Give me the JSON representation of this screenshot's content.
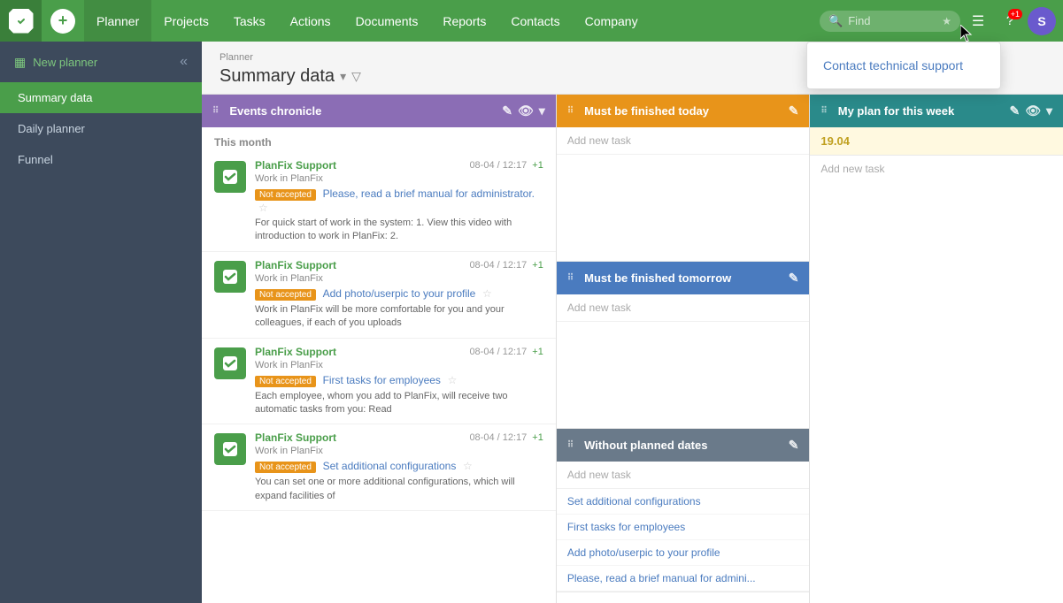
{
  "nav": {
    "logo_label": "F",
    "add_label": "+",
    "items": [
      {
        "label": "Planner",
        "active": true
      },
      {
        "label": "Projects"
      },
      {
        "label": "Tasks"
      },
      {
        "label": "Actions"
      },
      {
        "label": "Documents"
      },
      {
        "label": "Reports"
      },
      {
        "label": "Contacts"
      },
      {
        "label": "Company"
      }
    ],
    "search_placeholder": "Find",
    "avatar_label": "S",
    "badge_label": "+1"
  },
  "sidebar": {
    "new_planner_label": "New planner",
    "collapse_label": "«",
    "nav_items": [
      {
        "label": "Summary data",
        "active": true
      },
      {
        "label": "Daily planner"
      },
      {
        "label": "Funnel"
      }
    ]
  },
  "page": {
    "breadcrumb": "Planner",
    "title": "Summary data"
  },
  "events_panel": {
    "title": "Events chronicle",
    "month_label": "This month",
    "events": [
      {
        "author": "PlanFix Support",
        "time": "08-04 / 12:17",
        "plus": "+1",
        "project": "Work in PlanFix",
        "badge": "Not accepted",
        "task_link": "Please, read a brief manual for administrator.",
        "description": "For quick start of work in the system: 1. View this video with introduction to work in PlanFix: 2."
      },
      {
        "author": "PlanFix Support",
        "time": "08-04 / 12:17",
        "plus": "+1",
        "project": "Work in PlanFix",
        "badge": "Not accepted",
        "task_link": "Add photo/userpic to your profile",
        "description": "Work in PlanFix will be more comfortable for you and your colleagues, if each of you uploads"
      },
      {
        "author": "PlanFix Support",
        "time": "08-04 / 12:17",
        "plus": "+1",
        "project": "Work in PlanFix",
        "badge": "Not accepted",
        "task_link": "First tasks for employees",
        "description": "Each employee, whom you add to PlanFix, will receive two automatic tasks from you: Read"
      },
      {
        "author": "PlanFix Support",
        "time": "08-04 / 12:17",
        "plus": "+1",
        "project": "Work in PlanFix",
        "badge": "Not accepted",
        "task_link": "Set additional configurations",
        "description": "You can set one or more additional configurations, which will expand facilities of"
      }
    ]
  },
  "today_panel": {
    "title": "Must be finished today",
    "add_task_label": "Add new task"
  },
  "tomorrow_panel": {
    "title": "Must be finished tomorrow",
    "add_task_label": "Add new task"
  },
  "no_dates_panel": {
    "title": "Without planned dates",
    "add_task_label": "Add new task",
    "task_links": [
      "Set additional configurations",
      "First tasks for employees",
      "Add photo/userpic to your profile",
      "Please, read a brief manual for admini..."
    ]
  },
  "my_plan_panel": {
    "title": "My plan for this week",
    "date_label": "19.04",
    "add_task_label": "Add new task"
  },
  "dropdown": {
    "visible": true,
    "item_label": "Contact technical support"
  }
}
